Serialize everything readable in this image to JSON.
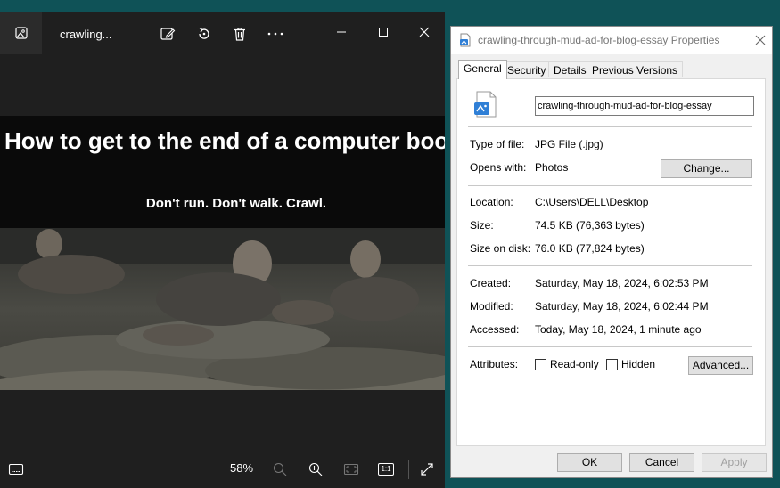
{
  "viewer": {
    "title": "crawling...",
    "image": {
      "headline": "How to get to the end of a computer book.",
      "subline": "Don't run. Don't walk. Crawl."
    },
    "zoom": "58%",
    "icons": {
      "app": "photos-app-icon",
      "edit": "edit-image-icon",
      "rotate": "rotate-icon",
      "delete": "delete-icon",
      "more": "more-options-icon",
      "minimize": "minimize-icon",
      "maximize": "maximize-icon",
      "close": "close-icon",
      "filmstrip": "filmstrip-icon",
      "zoom_out": "zoom-out-icon",
      "zoom_in": "zoom-in-icon",
      "fit": "fit-to-window-icon",
      "actual_size": "actual-size-icon",
      "fullscreen": "fullscreen-icon"
    },
    "actual_size_label": "1:1"
  },
  "dialog": {
    "title": "crawling-through-mud-ad-for-blog-essay Properties",
    "tabs": [
      "General",
      "Security",
      "Details",
      "Previous Versions"
    ],
    "file_name": "crawling-through-mud-ad-for-blog-essay",
    "fields": {
      "type_label": "Type of file:",
      "type_value": "JPG File (.jpg)",
      "opens_label": "Opens with:",
      "opens_value": "Photos",
      "change_button": "Change...",
      "location_label": "Location:",
      "location_value": "C:\\Users\\DELL\\Desktop",
      "size_label": "Size:",
      "size_value": "74.5 KB (76,363 bytes)",
      "size_on_disk_label": "Size on disk:",
      "size_on_disk_value": "76.0 KB (77,824 bytes)",
      "created_label": "Created:",
      "created_value": "Saturday, May 18, 2024, 6:02:53 PM",
      "modified_label": "Modified:",
      "modified_value": "Saturday, May 18, 2024, 6:02:44 PM",
      "accessed_label": "Accessed:",
      "accessed_value": "Today, May 18, 2024, 1 minute ago",
      "attributes_label": "Attributes:",
      "readonly_label": "Read-only",
      "hidden_label": "Hidden",
      "advanced_button": "Advanced..."
    },
    "buttons": {
      "ok": "OK",
      "cancel": "Cancel",
      "apply": "Apply"
    }
  }
}
